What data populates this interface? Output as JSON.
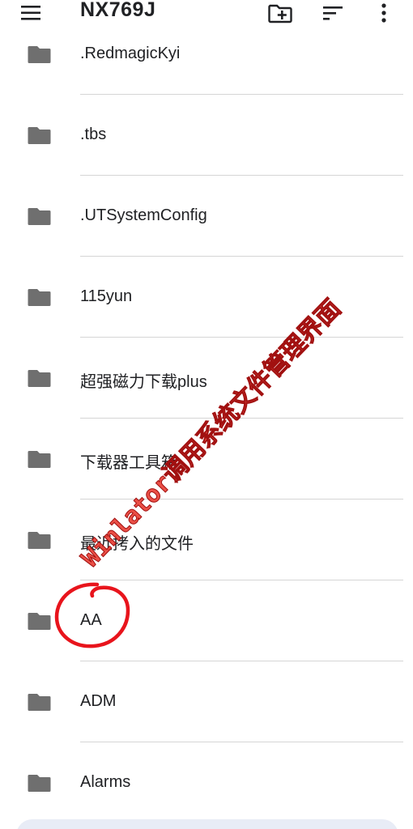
{
  "app": {
    "title": "NX769J",
    "accent_color": "#202124"
  },
  "toolbar": {
    "menu_icon": "hamburger-menu-icon",
    "new_folder_icon": "create-new-folder-icon",
    "sort_icon": "sort-icon",
    "more_icon": "more-vertical-icon"
  },
  "folders": [
    {
      "name": ".RedmagicKyi",
      "icon": "folder-icon"
    },
    {
      "name": ".tbs",
      "icon": "folder-icon"
    },
    {
      "name": ".UTSystemConfig",
      "icon": "folder-icon"
    },
    {
      "name": "115yun",
      "icon": "folder-icon"
    },
    {
      "name": "超强磁力下载plus",
      "icon": "folder-icon"
    },
    {
      "name": "下载器工具箱",
      "icon": "folder-icon"
    },
    {
      "name": "最近拷入的文件",
      "icon": "folder-icon"
    },
    {
      "name": "AA",
      "icon": "folder-icon"
    },
    {
      "name": "ADM",
      "icon": "folder-icon"
    },
    {
      "name": "Alarms",
      "icon": "folder-icon"
    }
  ],
  "overlay": {
    "watermark_text": "Winlator调用系统文件管理界面",
    "watermark_color": "#e83c32",
    "highlight_color": "#e8141c"
  }
}
